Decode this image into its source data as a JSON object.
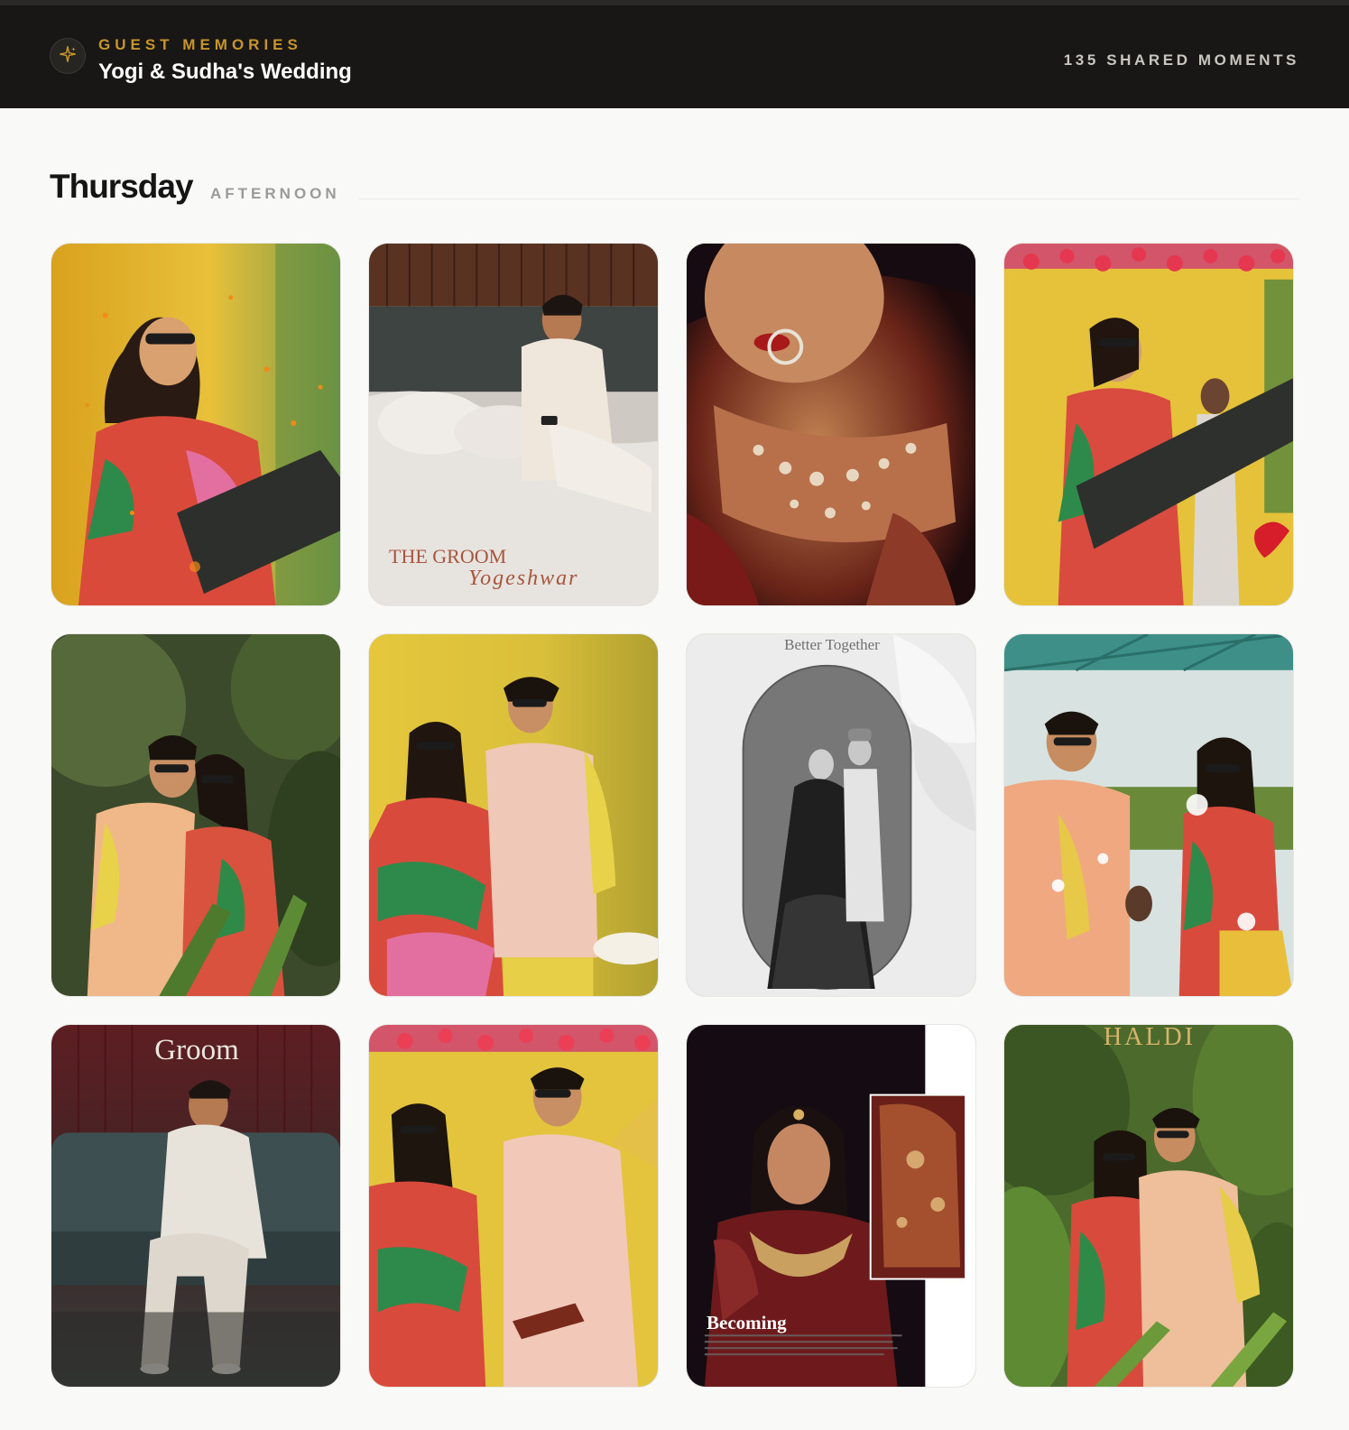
{
  "header": {
    "eyebrow": "GUEST MEMORIES",
    "title": "Yogi & Sudha's Wedding",
    "count": "135 SHARED MOMENTS",
    "badge_icon": "sparkle-icon",
    "accent_color": "#c8952a"
  },
  "section": {
    "day": "Thursday",
    "period": "AFTERNOON"
  },
  "photos": [
    {
      "subject": "Bride in sunglasses with confetti cannon at haldi"
    },
    {
      "subject": "Groom seated on bed with phone",
      "overlay_title": "THE GROOM",
      "overlay_script": "Yogeshwar"
    },
    {
      "subject": "Close-up of bridal necklace and nose ring"
    },
    {
      "subject": "Bride with confetti cannon in front of floral backdrop"
    },
    {
      "subject": "Couple embracing among plants"
    },
    {
      "subject": "Couple dancing in haldi outfits"
    },
    {
      "subject": "Black and white couple portrait in arch frame",
      "overlay_title": "Better Together"
    },
    {
      "subject": "Couple celebrating with guests outdoors"
    },
    {
      "subject": "Groom portrait on sofa",
      "overlay_title": "Groom"
    },
    {
      "subject": "Couple laughing at haldi ceremony"
    },
    {
      "subject": "Bride portrait with mehndi hands",
      "overlay_title": "Becoming"
    },
    {
      "subject": "Couple portrait in garden",
      "overlay_title": "HALDI"
    }
  ]
}
